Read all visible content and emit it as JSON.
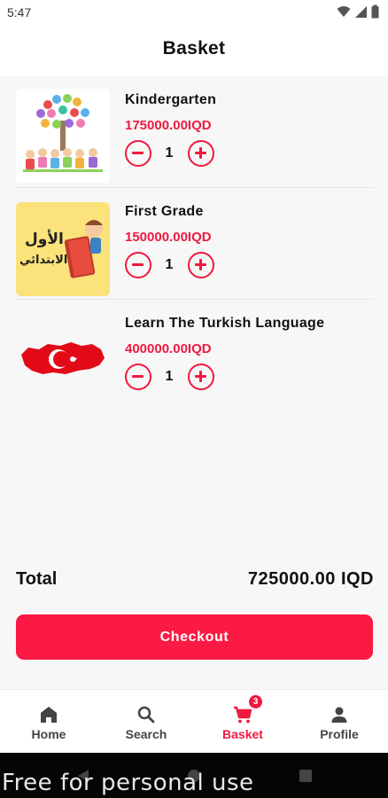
{
  "status": {
    "time": "5:47"
  },
  "header": {
    "title": "Basket"
  },
  "items": [
    {
      "name": "Kindergarten",
      "price": "175000.00IQD",
      "qty": "1"
    },
    {
      "name": "First Grade",
      "price": "150000.00IQD",
      "qty": "1",
      "image_text": {
        "line1": "الأول",
        "line2": "الابتدائي"
      }
    },
    {
      "name": "Learn The Turkish Language",
      "price": "400000.00IQD",
      "qty": "1"
    }
  ],
  "total": {
    "label": "Total",
    "value": "725000.00 IQD"
  },
  "checkout": {
    "label": "Checkout"
  },
  "nav": {
    "items": [
      {
        "label": "Home",
        "icon": "home-icon"
      },
      {
        "label": "Search",
        "icon": "search-icon"
      },
      {
        "label": "Basket",
        "icon": "cart-icon",
        "badge": "3"
      },
      {
        "label": "Profile",
        "icon": "person-icon"
      }
    ]
  },
  "watermark": "Free for personal use",
  "colors": {
    "accent": "#f0193f",
    "button": "#fb1a43",
    "background": "#f7f7f7"
  }
}
